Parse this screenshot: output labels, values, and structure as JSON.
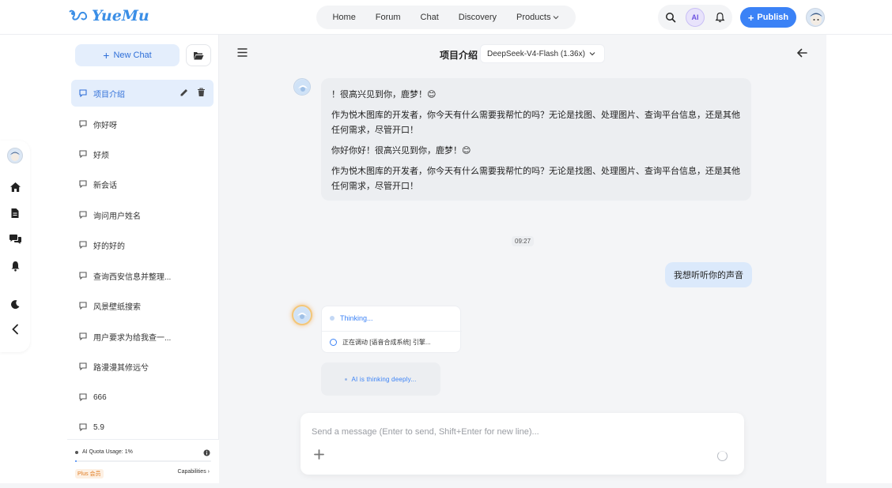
{
  "brand": {
    "logo_text": "YueMu"
  },
  "nav": {
    "items": [
      {
        "label": "Home"
      },
      {
        "label": "Forum"
      },
      {
        "label": "Chat"
      },
      {
        "label": "Discovery"
      },
      {
        "label": "Products"
      }
    ]
  },
  "toolbar": {
    "ai_label": "AI",
    "publish_label": "Publish"
  },
  "sidebar": {
    "new_chat_label": "New Chat",
    "conversations": [
      {
        "title": "项目介绍",
        "active": true
      },
      {
        "title": "你好呀"
      },
      {
        "title": "好烦"
      },
      {
        "title": "新会话"
      },
      {
        "title": "询问用户姓名"
      },
      {
        "title": "好的好的"
      },
      {
        "title": "查询西安信息并整理..."
      },
      {
        "title": "风景壁纸搜索"
      },
      {
        "title": "用户要求为给我查一..."
      },
      {
        "title": "路漫漫其修远兮"
      },
      {
        "title": "666"
      },
      {
        "title": "5.9"
      }
    ],
    "quota": {
      "label": "AI Quota Usage: 1%",
      "percent": 1
    },
    "plan_badge": "Plus 会员",
    "capabilities_label": "Capabilities"
  },
  "chat": {
    "title": "项目介绍",
    "model": "DeepSeek-V4-Flash (1.36x)",
    "messages": {
      "bot_1": {
        "p1": "！很高兴见到你，鹿梦！😊",
        "p2": "作为悦木图库的开发者，你今天有什么需要我帮忙的吗？无论是找图、处理图片、查询平台信息，还是其他任何需求，尽管开口！",
        "p3": "你好你好！很高兴见到你，鹿梦！😊",
        "p4": "作为悦木图库的开发者，你今天有什么需要我帮忙的吗？无论是找图、处理图片、查询平台信息，还是其他任何需求，尽管开口！"
      },
      "timestamp": "09:27",
      "user_1": "我想听听你的声音",
      "thinking_label": "Thinking...",
      "tool_call": "正在调动 [语音合成系统] 引擎...",
      "deep_thinking": "AI is thinking deeply..."
    },
    "composer_placeholder": "Send a message (Enter to send, Shift+Enter for new line)..."
  },
  "colors": {
    "accent": "#3b82f6",
    "active_bg": "#e4eefc"
  }
}
